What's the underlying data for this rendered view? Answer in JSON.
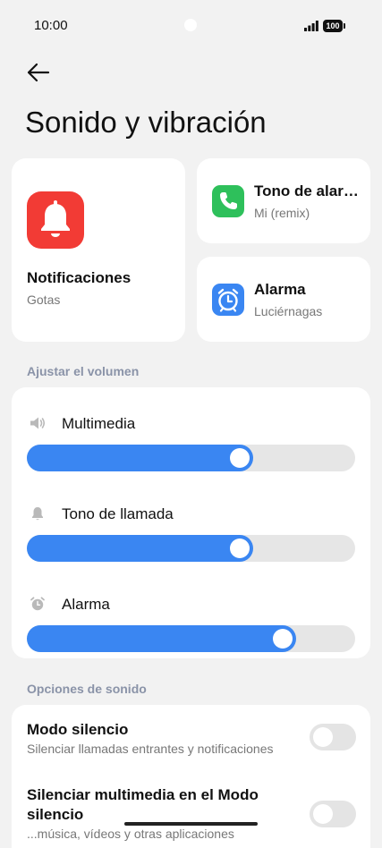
{
  "status_bar": {
    "time": "10:00",
    "battery": "100"
  },
  "header": {
    "title": "Sonido y vibración"
  },
  "shortcuts": {
    "notifications": {
      "title": "Notificaciones",
      "subtitle": "Gotas",
      "icon": "bell-icon",
      "color": "#f23b35"
    },
    "alarm_tone": {
      "title": "Tono de alarma",
      "subtitle": "Mi (remix)",
      "icon": "phone-icon",
      "color": "#2ec05b"
    },
    "alarm": {
      "title": "Alarma",
      "subtitle": "Luciérnagas",
      "icon": "alarm-clock-icon",
      "color": "#3a86f2"
    }
  },
  "volume": {
    "section_title": "Ajustar el volumen",
    "items": [
      {
        "label": "Multimedia",
        "icon": "speaker-icon",
        "level": 0.69
      },
      {
        "label": "Tono de llamada",
        "icon": "bell-icon",
        "level": 0.69
      },
      {
        "label": "Alarma",
        "icon": "alarm-clock-icon",
        "level": 0.82
      }
    ],
    "accent": "#3a86f2"
  },
  "sound_options": {
    "section_title": "Opciones de sonido",
    "items": [
      {
        "title": "Modo silencio",
        "subtitle": "Silenciar llamadas entrantes y notificaciones",
        "enabled": false
      },
      {
        "title": "Silenciar multimedia en el Modo silencio",
        "subtitle": "...música, vídeos y otras aplicaciones",
        "enabled": false
      }
    ]
  }
}
